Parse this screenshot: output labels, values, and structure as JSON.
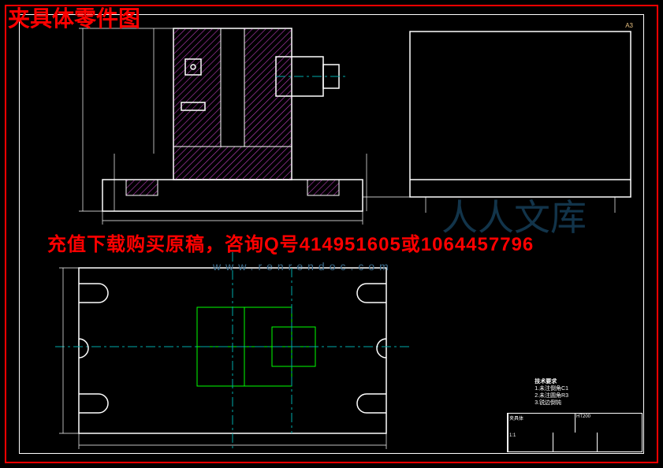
{
  "title": "夹具体零件图",
  "watermark_text": "充值下载购买原稿，咨询Q号414951605或1064457796",
  "watermark_url": "www.renrendoc.com",
  "watermark_brand": "人人文库",
  "corner_tag": "A3",
  "tech_requirements_heading": "技术要求",
  "tech_requirements": "1.未注倒角C1\n2.未注圆角R3\n3.锐边倒钝",
  "title_block": {
    "part_name": "夹具体",
    "material": "HT200",
    "scale": "1:1",
    "drawn": "",
    "checked": "",
    "sheet": ""
  },
  "drawing": {
    "type": "engineering_drawing",
    "views": [
      "front_section",
      "top",
      "side"
    ],
    "colors": {
      "border": "#f00",
      "frame": "#fff",
      "hatch": "#c040c0",
      "centerline": "#0aa",
      "hidden": "#0f0"
    }
  }
}
